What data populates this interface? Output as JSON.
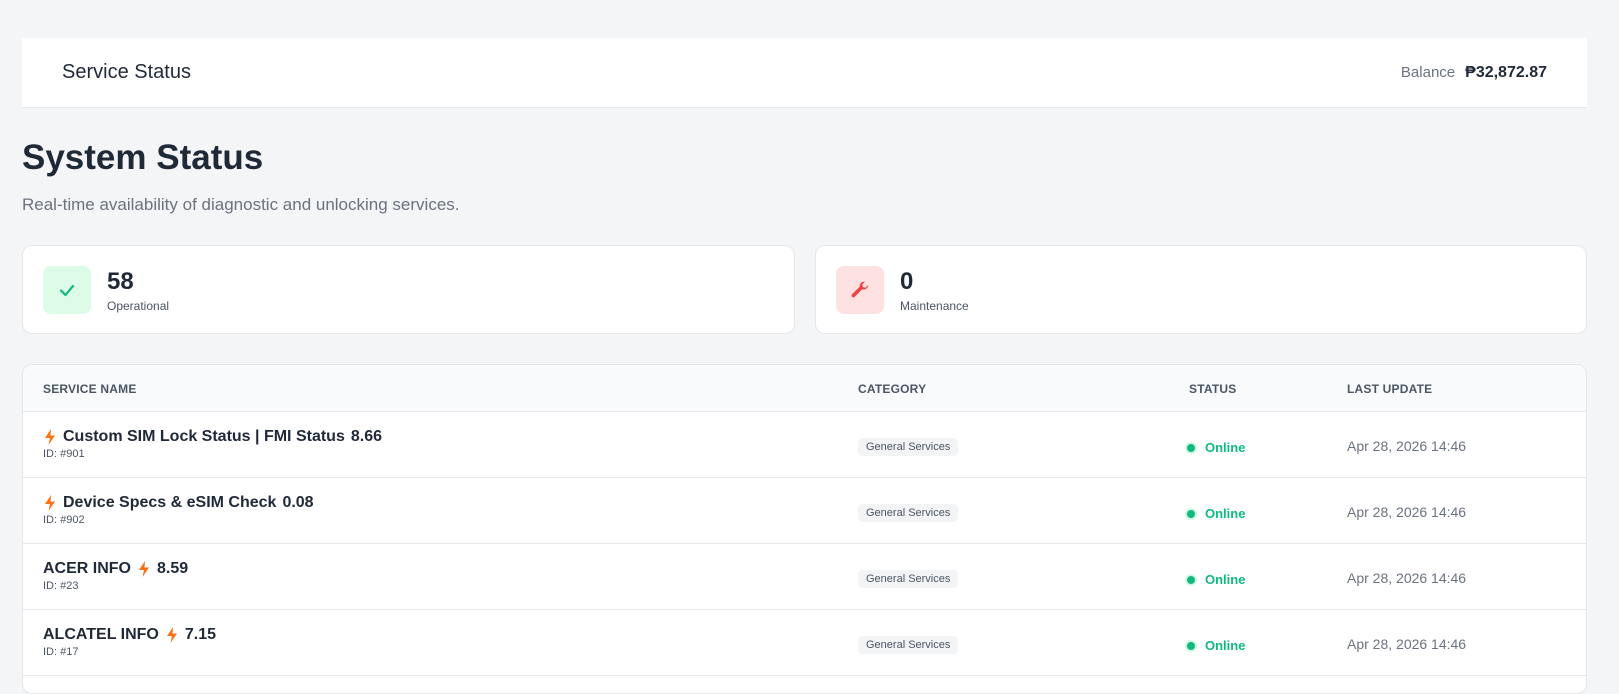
{
  "header": {
    "title": "Service Status",
    "balance_label": "Balance",
    "balance_value": "₱32,872.87"
  },
  "page": {
    "title": "System Status",
    "subtitle": "Real-time availability of diagnostic and unlocking services."
  },
  "stats": [
    {
      "value": "58",
      "label": "Operational",
      "icon": "check-icon",
      "color": "#10b981"
    },
    {
      "value": "0",
      "label": "Maintenance",
      "icon": "wrench-icon",
      "color": "#ef4444"
    }
  ],
  "table": {
    "headers": [
      "SERVICE NAME",
      "CATEGORY",
      "STATUS",
      "LAST UPDATE"
    ],
    "rows": [
      {
        "prefix": "",
        "name": "Custom SIM Lock Status | FMI Status",
        "price": "8.66",
        "id": "ID: #901",
        "category": "General Services",
        "status": "Online",
        "updated": "Apr 28, 2026 14:46"
      },
      {
        "prefix": "",
        "name": "Device Specs & eSIM Check",
        "price": "0.08",
        "id": "ID: #902",
        "category": "General Services",
        "status": "Online",
        "updated": "Apr 28, 2026 14:46"
      },
      {
        "prefix": "ACER INFO",
        "name": "",
        "price": "8.59",
        "id": "ID: #23",
        "category": "General Services",
        "status": "Online",
        "updated": "Apr 28, 2026 14:46"
      },
      {
        "prefix": "ALCATEL INFO",
        "name": "",
        "price": "7.15",
        "id": "ID: #17",
        "category": "General Services",
        "status": "Online",
        "updated": "Apr 28, 2026 14:46"
      }
    ]
  },
  "colors": {
    "accent_orange": "#f97316",
    "online_green": "#10b981"
  }
}
